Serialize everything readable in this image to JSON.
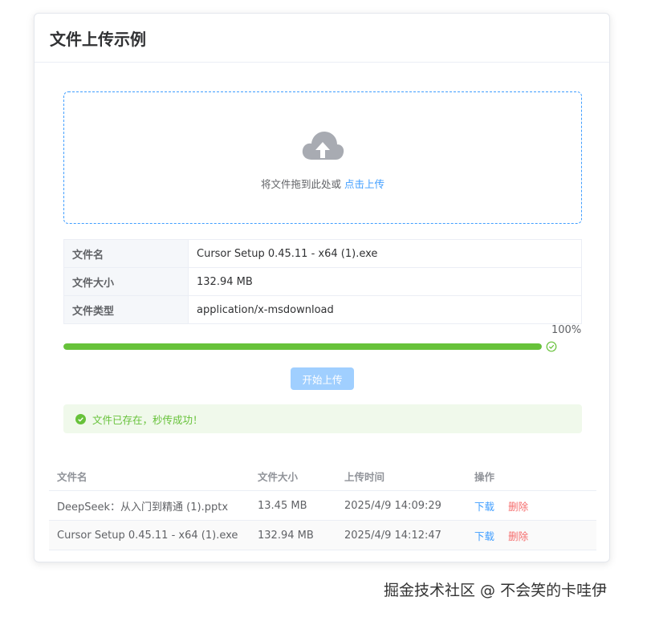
{
  "header": {
    "title": "文件上传示例"
  },
  "upload": {
    "icon": "cloud-upload-icon",
    "prompt": "将文件拖到此处或",
    "link_text": "点击上传"
  },
  "file_info": [
    {
      "label": "文件名",
      "value": "Cursor Setup 0.45.11 - x64 (1).exe"
    },
    {
      "label": "文件大小",
      "value": "132.94 MB"
    },
    {
      "label": "文件类型",
      "value": "application/x-msdownload"
    }
  ],
  "progress": {
    "percent_text": "100%",
    "value": 1.0,
    "color": "#67c23a",
    "status_icon": "check-circle-icon"
  },
  "start_button": {
    "label": "开始上传",
    "disabled": true
  },
  "alert": {
    "text": "文件已存在，秒传成功！",
    "icon": "success-check-icon",
    "color": "#67c23a"
  },
  "files_table": {
    "headers": [
      "文件名",
      "文件大小",
      "上传时间",
      "操作"
    ],
    "rows": [
      {
        "name": "DeepSeek：从入门到精通 (1).pptx",
        "size": "13.45 MB",
        "time": "2025/4/9 14:09:29",
        "download": "下载",
        "delete": "删除"
      },
      {
        "name": "Cursor Setup 0.45.11 - x64 (1).exe",
        "size": "132.94 MB",
        "time": "2025/4/9 14:12:47",
        "download": "下载",
        "delete": "删除"
      }
    ]
  },
  "colors": {
    "primary": "#409eff",
    "success": "#67c23a",
    "danger": "#f56c6c"
  },
  "watermark": "掘金技术社区 @ 不会笑的卡哇伊"
}
